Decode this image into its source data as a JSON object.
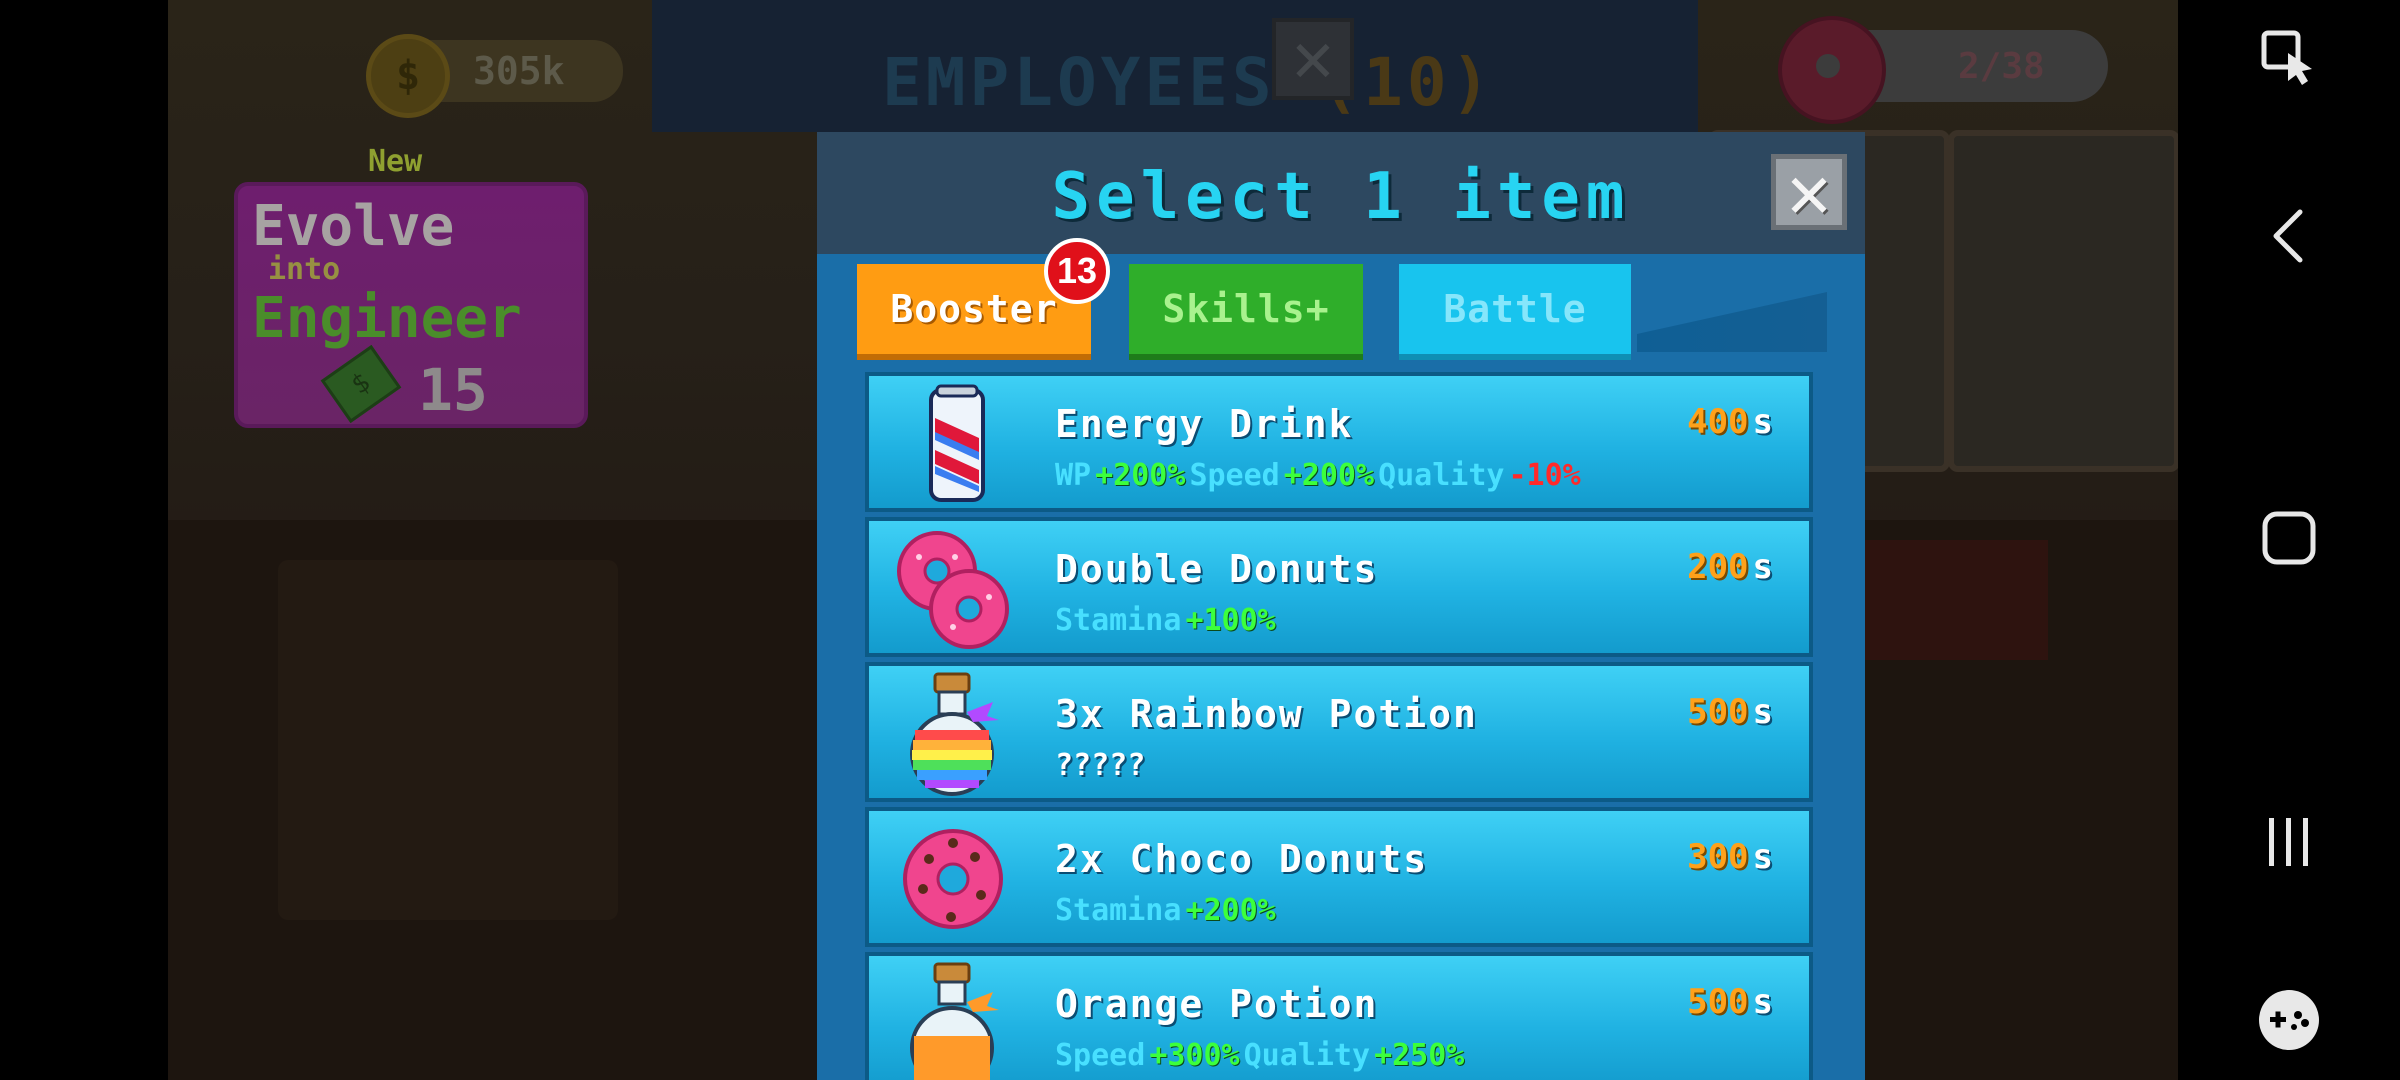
{
  "hud": {
    "money": "305k",
    "donuts": "2/38",
    "coin_icon": "$"
  },
  "evolve": {
    "new_label": "New",
    "line1": "Evolve",
    "line2": "into",
    "line3": "Engineer",
    "cost": "15"
  },
  "employees_header": {
    "title": "EMPLOYEES",
    "count": "(10)"
  },
  "modal": {
    "title": "Select 1 item",
    "close_glyph": "✕"
  },
  "tabs": {
    "booster": "Booster",
    "booster_badge": "13",
    "skills": "Skills+",
    "battle": "Battle"
  },
  "items": [
    {
      "name": "Energy Drink",
      "time": "400",
      "unit": "s",
      "icon": "energy-drink-can",
      "effects": [
        {
          "label": "WP",
          "value": "+200%"
        },
        {
          "label": "Speed",
          "value": "+200%"
        },
        {
          "label": "Quality",
          "value": "-10%"
        }
      ]
    },
    {
      "name": "Double Donuts",
      "time": "200",
      "unit": "s",
      "icon": "double-donut",
      "effects": [
        {
          "label": "Stamina",
          "value": "+100%"
        }
      ]
    },
    {
      "name": "3x Rainbow Potion",
      "time": "500",
      "unit": "s",
      "icon": "rainbow-potion",
      "effects_text": "?????"
    },
    {
      "name": "2x Choco Donuts",
      "time": "300",
      "unit": "s",
      "icon": "choco-donut",
      "effects": [
        {
          "label": "Stamina",
          "value": "+200%"
        }
      ]
    },
    {
      "name": "Orange Potion",
      "time": "500",
      "unit": "s",
      "icon": "orange-potion",
      "effects": [
        {
          "label": "Speed",
          "value": "+300%"
        },
        {
          "label": "Quality",
          "value": "+250%"
        }
      ]
    }
  ],
  "colors": {
    "accent_title": "#27d4f2",
    "booster_tab": "#ff9c12",
    "skills_tab": "#2fae2a",
    "battle_tab": "#18c4ee",
    "time_value": "#ffa11a",
    "positive": "#3cff3c",
    "negative": "#ff2a2a"
  }
}
